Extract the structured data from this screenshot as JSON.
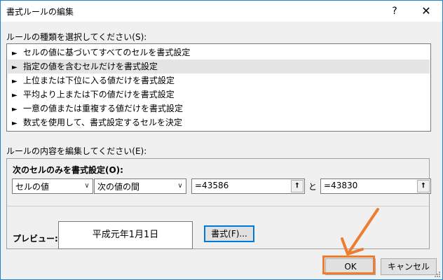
{
  "window": {
    "title": "書式ルールの編集",
    "help_glyph": "?",
    "close_glyph": "✕"
  },
  "rule_type": {
    "label": "ルールの種類を選択してください(S):",
    "items": [
      {
        "label": "セルの値に基づいてすべてのセルを書式設定",
        "selected": false
      },
      {
        "label": "指定の値を含むセルだけを書式設定",
        "selected": true
      },
      {
        "label": "上位または下位に入る値だけを書式設定",
        "selected": false
      },
      {
        "label": "平均より上または下の値だけを書式設定",
        "selected": false
      },
      {
        "label": "一意の値または重複する値だけを書式設定",
        "selected": false
      },
      {
        "label": "数式を使用して、書式設定するセルを決定",
        "selected": false
      }
    ],
    "item_arrow": "►"
  },
  "rule_content": {
    "label": "ルールの内容を編集してください(E):",
    "section_title": "次のセルのみを書式設定(O):",
    "condition_type": "セルの値",
    "operator": "次の値の間",
    "value1": "=43586",
    "and_label": "と",
    "value2": "=43830",
    "ref_glyph": "⭡",
    "dropdown_glyph": "∨"
  },
  "preview": {
    "label": "プレビュー:",
    "sample_text": "平成元年1月1日",
    "format_button": "書式(F)..."
  },
  "buttons": {
    "ok": "OK",
    "cancel": "キャンセル"
  },
  "colors": {
    "accent": "#0078d7",
    "annotation": "#ed7d31",
    "selection": "#e5e5e5"
  },
  "annotations": {
    "ok_highlight": "orange-box",
    "pointer": "orange-arrow"
  }
}
